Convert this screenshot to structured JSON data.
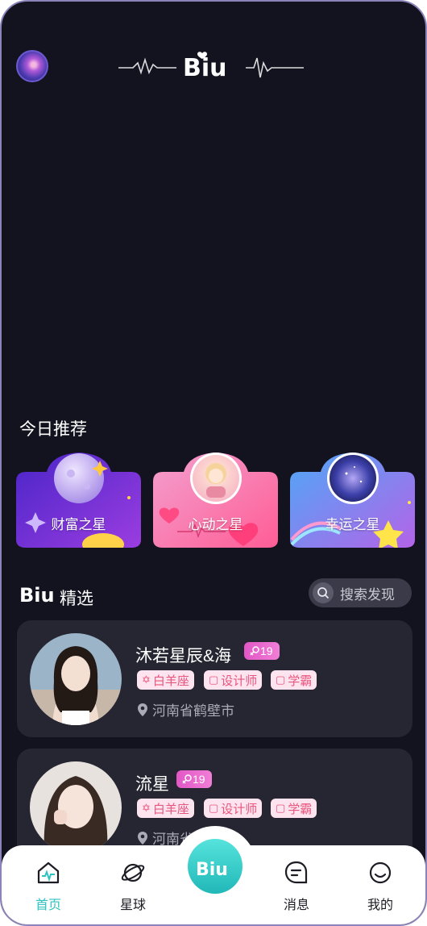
{
  "header": {
    "logo_text": "Biu"
  },
  "today": {
    "title": "今日推荐",
    "cards": [
      {
        "label": "财富之星",
        "colors": [
          "#5b2bd6",
          "#8b3fe3"
        ]
      },
      {
        "label": "心动之星",
        "colors": [
          "#f06aa8",
          "#ff7fb2"
        ]
      },
      {
        "label": "幸运之星",
        "colors": [
          "#5a7cf0",
          "#a05be8"
        ]
      }
    ]
  },
  "featured": {
    "title": "精选",
    "logo_text": "Biu"
  },
  "search": {
    "placeholder": "搜索发现"
  },
  "profiles": [
    {
      "name": "沐若星辰&海",
      "age": "19",
      "tags": [
        "白羊座",
        "设计师",
        "学霸"
      ],
      "location": "河南省鹤壁市"
    },
    {
      "name": "流星",
      "age": "19",
      "tags": [
        "白羊座",
        "设计师",
        "学霸"
      ],
      "location": "河南省"
    }
  ],
  "tabs": [
    {
      "label": "首页",
      "icon": "home-icon",
      "active": true
    },
    {
      "label": "星球",
      "icon": "planet-icon"
    },
    {
      "label": "消息",
      "icon": "message-icon"
    },
    {
      "label": "我的",
      "icon": "smile-icon"
    }
  ],
  "center_button": {
    "label": "Biu"
  },
  "colors": {
    "accent": "#2ec3c0",
    "tag_bg": "#fde4ee",
    "tag_text": "#e8567f",
    "age_bg": "#e257c6"
  }
}
